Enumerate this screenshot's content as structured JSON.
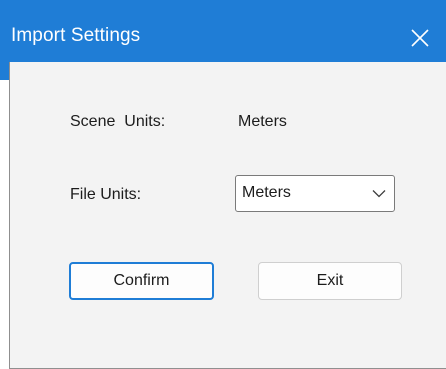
{
  "window": {
    "title": "Import Settings",
    "close_icon": "close-icon",
    "accent": "#1f7dd6",
    "background": "#f3f3f3"
  },
  "form": {
    "scene_units_label": "Scene  Units:",
    "scene_units_value": "Meters",
    "file_units_label": "File Units:",
    "file_units_selected": "Meters",
    "dropdown_icon": "chevron-down-icon"
  },
  "buttons": {
    "confirm_label": "Confirm",
    "exit_label": "Exit"
  }
}
